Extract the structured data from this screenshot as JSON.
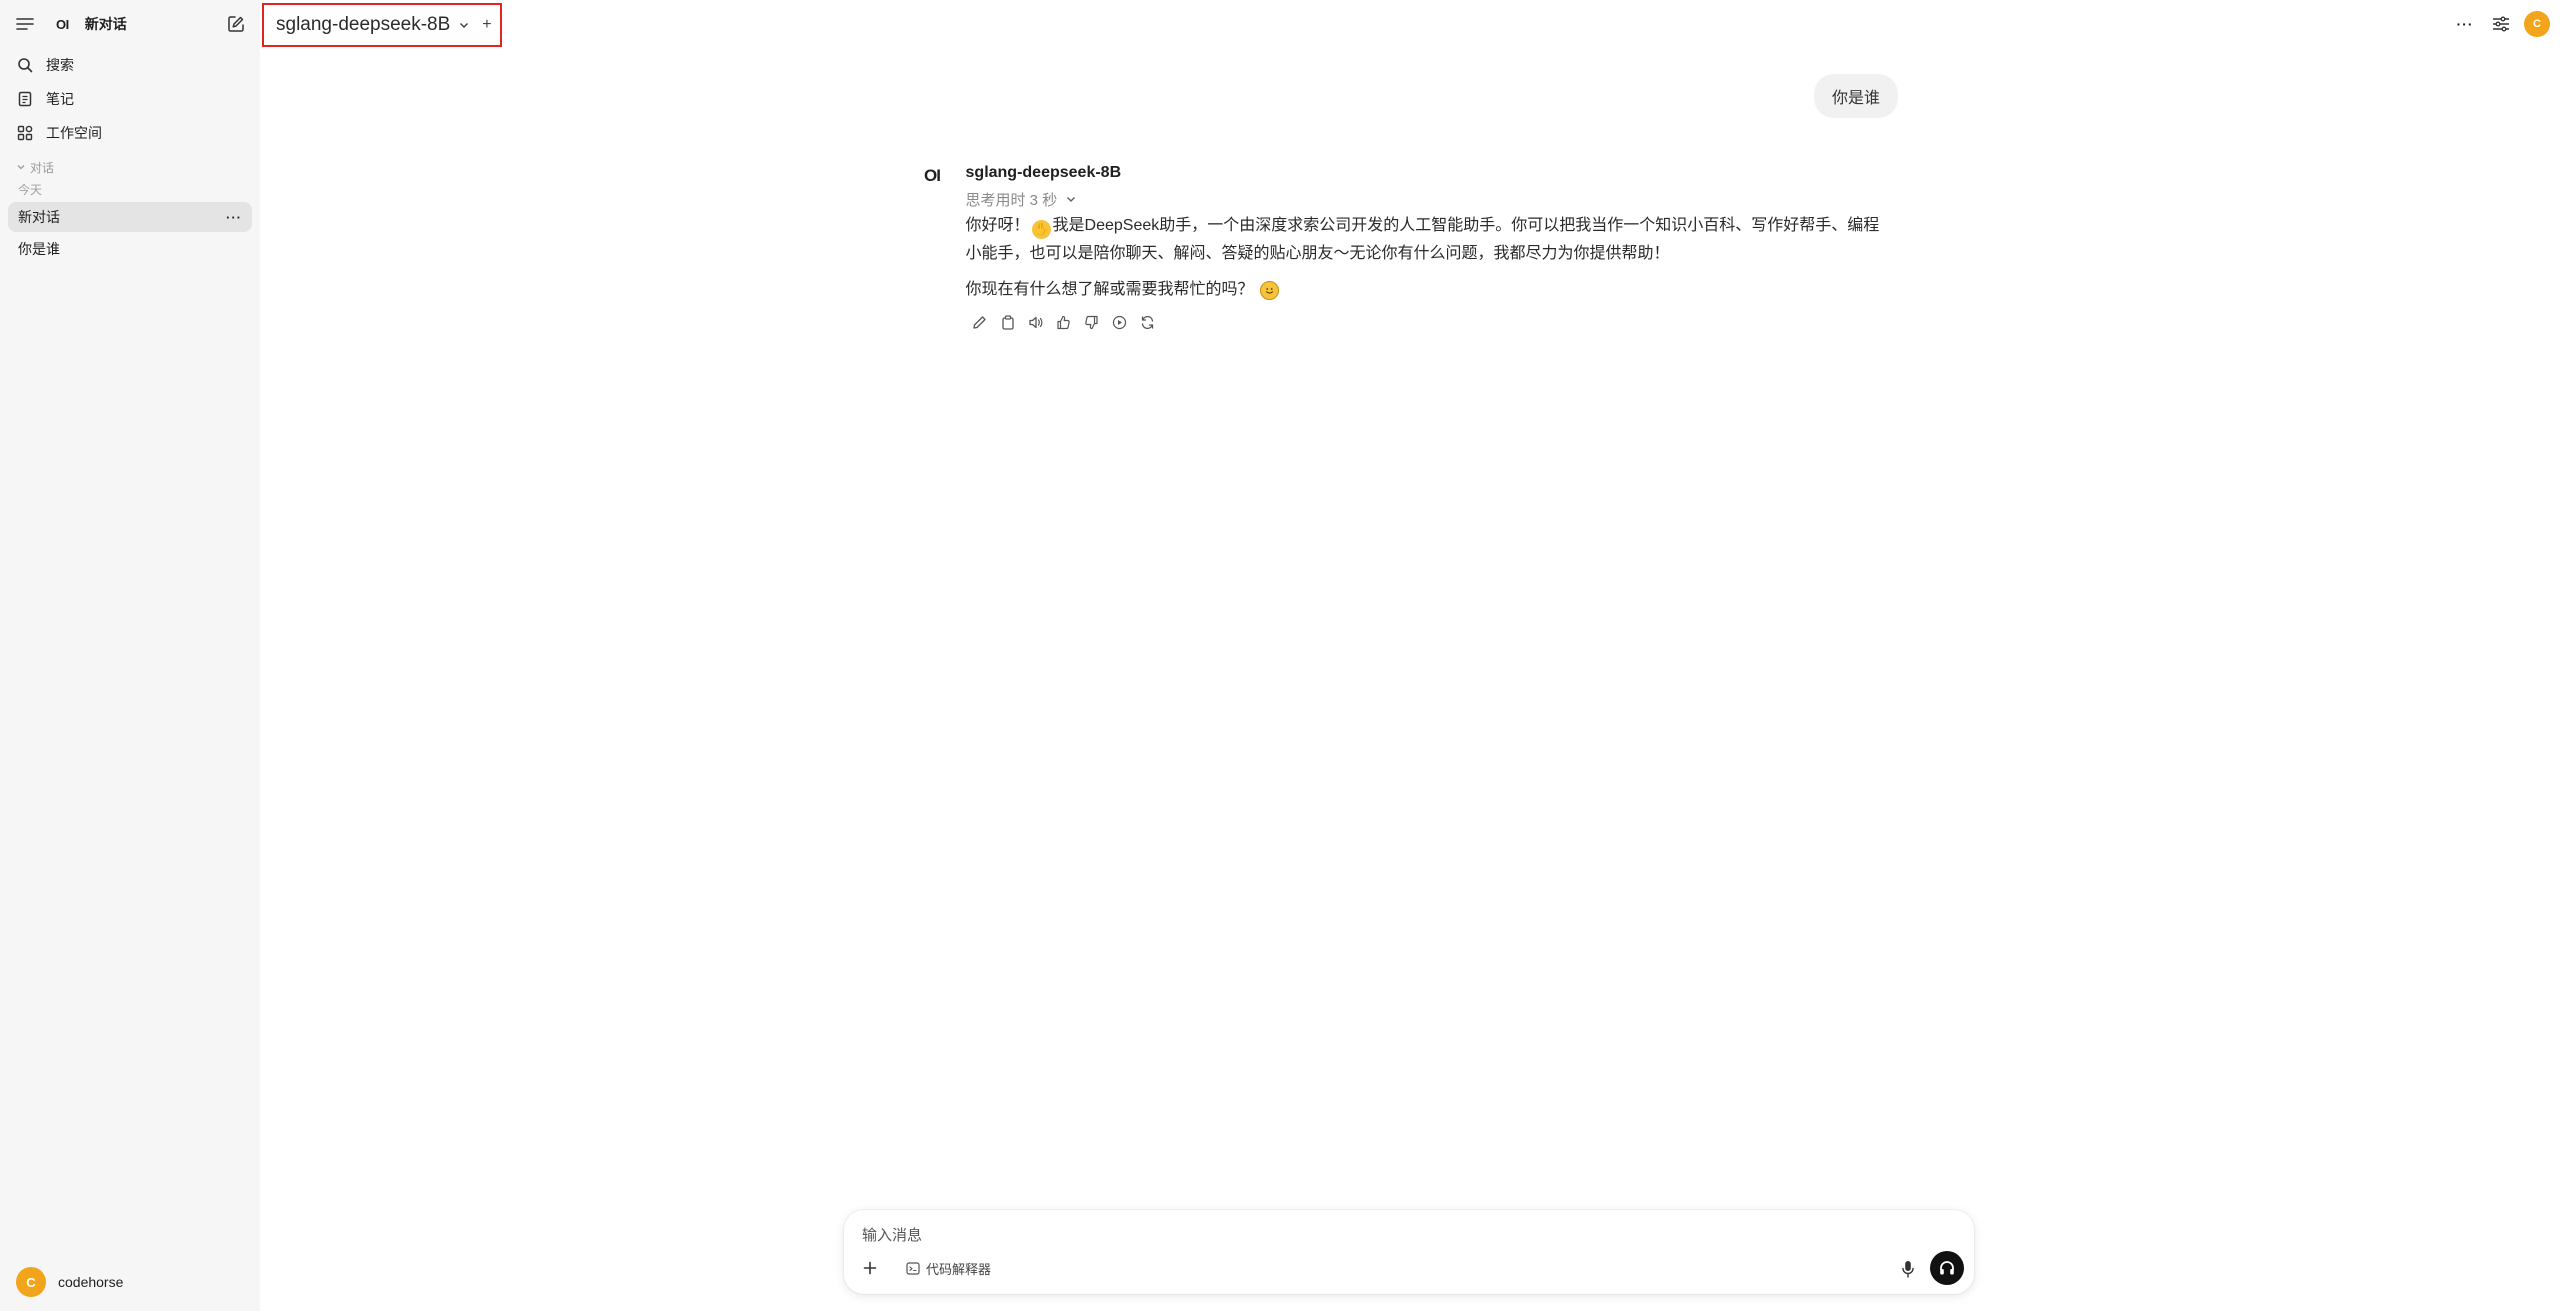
{
  "sidebar": {
    "logo": "OI",
    "new_chat_label": "新对话",
    "nav": [
      {
        "label": "搜索",
        "icon": "search-icon"
      },
      {
        "label": "笔记",
        "icon": "notes-icon"
      },
      {
        "label": "工作空间",
        "icon": "workspace-icon"
      }
    ],
    "section_label": "对话",
    "date_group": "今天",
    "chats": [
      {
        "title": "新对话",
        "active": true,
        "more": "···"
      },
      {
        "title": "你是谁",
        "active": false
      }
    ],
    "user": {
      "avatar_initial": "C",
      "name": "codehorse"
    }
  },
  "header": {
    "model_name": "sglang-deepseek-8B",
    "add_model": "+",
    "more": "···",
    "avatar_initial": "C"
  },
  "chat": {
    "user_message": "你是谁",
    "assistant": {
      "logo": "OI",
      "name": "sglang-deepseek-8B",
      "thinking": "思考用时 3 秒",
      "paragraph1_pre": "你好呀！",
      "paragraph1_post": "我是DeepSeek助手，一个由深度求索公司开发的人工智能助手。你可以把我当作一个知识小百科、写作好帮手、编程小能手，也可以是陪你聊天、解闷、答疑的贴心朋友～无论你有什么问题，我都尽力为你提供帮助！",
      "paragraph2": "你现在有什么想了解或需要我帮忙的吗？",
      "actions": [
        "edit-icon",
        "copy-icon",
        "read-aloud-icon",
        "thumbs-up-icon",
        "thumbs-down-icon",
        "continue-icon",
        "regenerate-icon"
      ]
    }
  },
  "composer": {
    "placeholder": "输入消息",
    "tool_label": "代码解释器"
  },
  "colors": {
    "accent_avatar": "#f2a51a",
    "highlight_border": "#e0251f",
    "sidebar_bg": "#f6f6f6"
  }
}
